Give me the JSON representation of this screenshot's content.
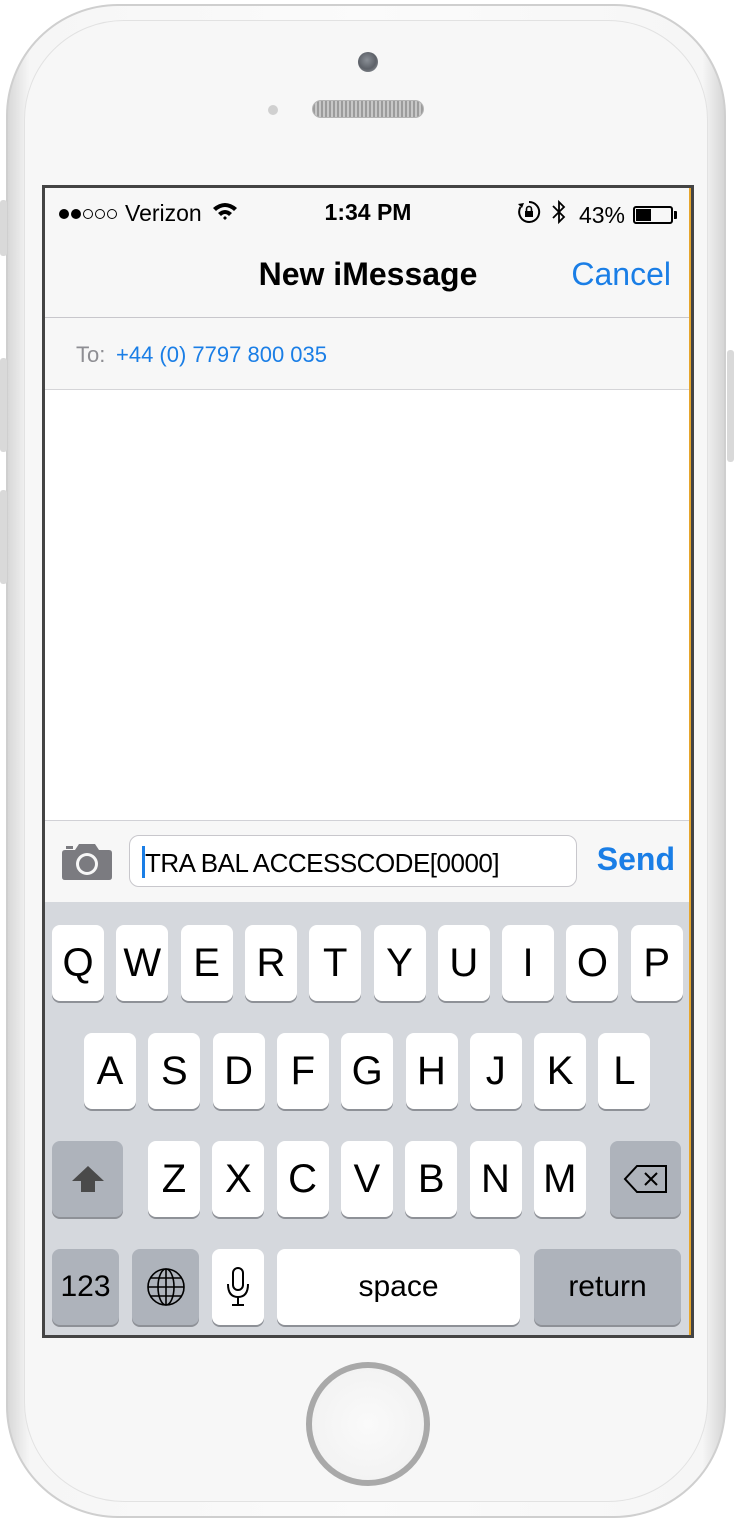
{
  "status_bar": {
    "signal_full": 2,
    "signal_total": 5,
    "carrier": "Verizon",
    "time": "1:34 PM",
    "battery_percent": "43%",
    "battery_level": 0.43
  },
  "nav": {
    "title": "New iMessage",
    "cancel_label": "Cancel"
  },
  "recipient": {
    "label": "To:",
    "value": "+44 (0) 7797 800 035"
  },
  "compose": {
    "text": "TRA BAL ACCESSCODE[0000]",
    "send_label": "Send"
  },
  "keyboard": {
    "row1": [
      "Q",
      "W",
      "E",
      "R",
      "T",
      "Y",
      "U",
      "I",
      "O",
      "P"
    ],
    "row2": [
      "A",
      "S",
      "D",
      "F",
      "G",
      "H",
      "J",
      "K",
      "L"
    ],
    "row3": [
      "Z",
      "X",
      "C",
      "V",
      "B",
      "N",
      "M"
    ],
    "numbers_label": "123",
    "space_label": "space",
    "return_label": "return"
  },
  "colors": {
    "accent": "#1a7ee6",
    "keyboard_bg": "#d5d8dd",
    "special_key": "#aeb3bb"
  },
  "icons": [
    "wifi-icon",
    "orientation-lock-icon",
    "bluetooth-icon",
    "battery-icon",
    "camera-icon",
    "shift-icon",
    "backspace-icon",
    "globe-icon",
    "microphone-icon"
  ]
}
